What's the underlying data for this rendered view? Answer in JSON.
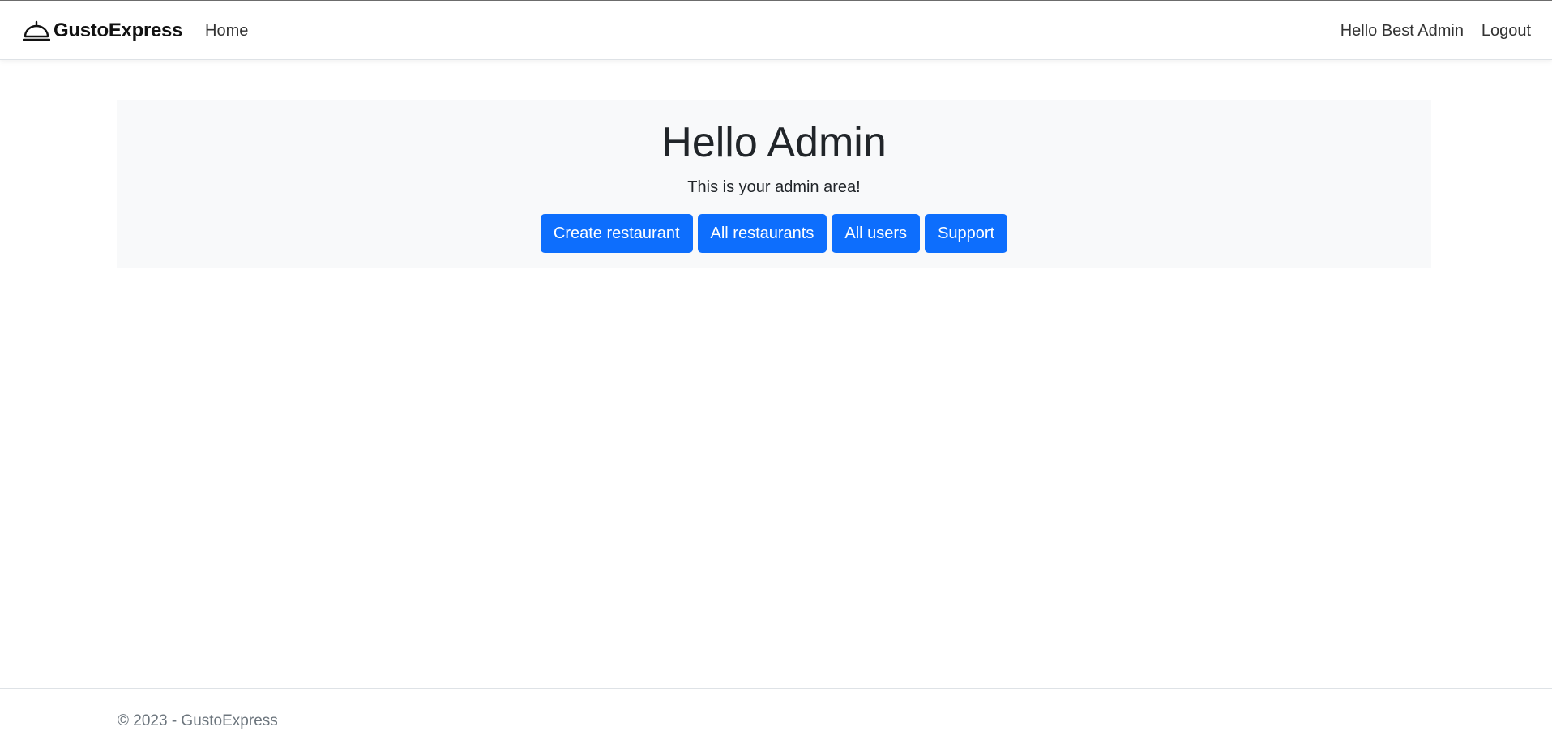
{
  "navbar": {
    "brand": "GustoExpress",
    "brand_icon": "cloche-icon",
    "home_label": "Home",
    "greeting": "Hello Best Admin",
    "logout_label": "Logout"
  },
  "hero": {
    "title": "Hello Admin",
    "subtitle": "This is your admin area!",
    "buttons": [
      {
        "label": "Create restaurant"
      },
      {
        "label": "All restaurants"
      },
      {
        "label": "All users"
      },
      {
        "label": "Support"
      }
    ]
  },
  "footer": {
    "text": "© 2023 - GustoExpress"
  },
  "colors": {
    "primary": "#0d6efd",
    "jumbotron_bg": "#f8f9fa",
    "footer_text": "#6c757d"
  }
}
